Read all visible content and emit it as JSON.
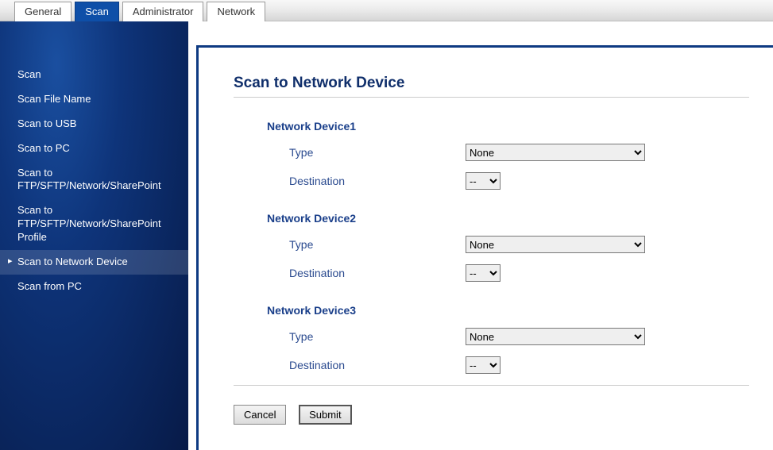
{
  "tabs": {
    "general": "General",
    "scan": "Scan",
    "administrator": "Administrator",
    "network": "Network"
  },
  "sidebar": {
    "items": [
      "Scan",
      "Scan File Name",
      "Scan to USB",
      "Scan to PC",
      "Scan to FTP/SFTP/Network/SharePoint",
      "Scan to FTP/SFTP/Network/SharePoint Profile",
      "Scan to Network Device",
      "Scan from PC"
    ],
    "active_index": 6
  },
  "page": {
    "title": "Scan to Network Device",
    "groups": [
      {
        "name": "Network Device1",
        "type_label": "Type",
        "type_value": "None",
        "dest_label": "Destination",
        "dest_value": "--"
      },
      {
        "name": "Network Device2",
        "type_label": "Type",
        "type_value": "None",
        "dest_label": "Destination",
        "dest_value": "--"
      },
      {
        "name": "Network Device3",
        "type_label": "Type",
        "type_value": "None",
        "dest_label": "Destination",
        "dest_value": "--"
      }
    ],
    "cancel": "Cancel",
    "submit": "Submit"
  }
}
